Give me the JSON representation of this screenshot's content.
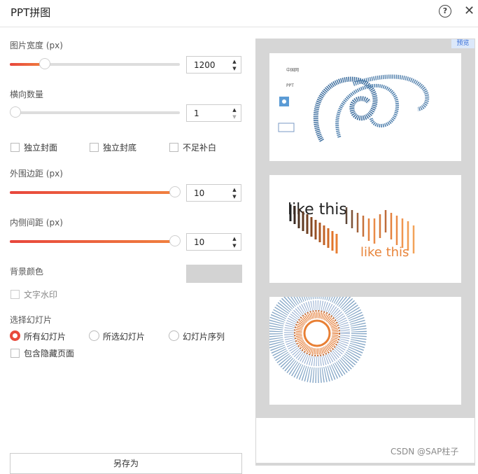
{
  "window": {
    "title": "PPT拼图",
    "help_icon": "?",
    "close_icon": "✕"
  },
  "width_setting": {
    "label": "图片宽度 (px)",
    "value": "1200",
    "fraction": 0.2
  },
  "columns_setting": {
    "label": "横向数量",
    "value": "1",
    "fraction": 0.0
  },
  "checkboxes": {
    "cover": "独立封面",
    "back": "独立封底",
    "fill": "不足补白"
  },
  "outer_margin": {
    "label": "外围边距 (px)",
    "value": "10",
    "fraction": 1.0
  },
  "inner_spacing": {
    "label": "内侧间距 (px)",
    "value": "10",
    "fraction": 1.0
  },
  "background": {
    "label": "背景颜色",
    "color": "#d3d3d3"
  },
  "watermark_text": {
    "label": "文字水印"
  },
  "slide_selection": {
    "label": "选择幻灯片",
    "options": [
      "所有幻灯片",
      "所选幻灯片",
      "幻灯片序列"
    ],
    "selected": "所有幻灯片",
    "include_hidden": "包含隐藏页面"
  },
  "save_button": "另存为",
  "preview": {
    "badge": "预览",
    "slide1_texts": [
      "中国网",
      "PPT"
    ],
    "slide2_text": "like this"
  },
  "footer_watermark": "CSDN @SAP柱子",
  "colors": {
    "accent": "#e8463c",
    "blue_art": "#3f6f9f",
    "orange_art": "#e2742a"
  }
}
